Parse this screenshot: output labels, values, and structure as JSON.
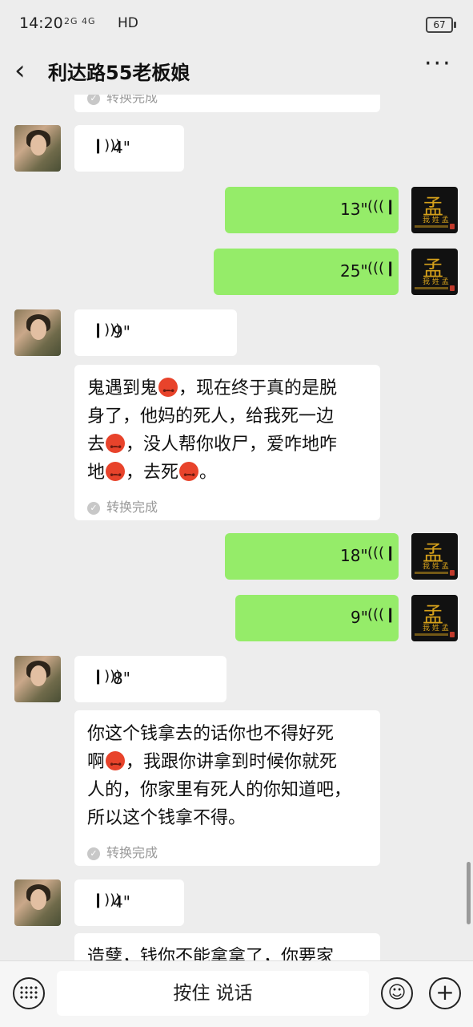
{
  "status_bar": {
    "time": "14:20",
    "signal": "2G 4G",
    "hd": "HD",
    "battery": "67"
  },
  "header": {
    "back_icon": "chevron-left-icon",
    "title": "利达路55老板娘",
    "more_icon": "more-dots-icon"
  },
  "chat": {
    "partial_top_done": "转换完成",
    "voice_icon_left": "))",
    "messages": [
      {
        "side": "left",
        "duration": "4\""
      },
      {
        "side": "right",
        "duration": "13\""
      },
      {
        "side": "right",
        "duration": "25\""
      },
      {
        "side": "left",
        "duration": "9\""
      },
      {
        "side": "right",
        "duration": "18\""
      },
      {
        "side": "right",
        "duration": "9\""
      },
      {
        "side": "left",
        "duration": "8\""
      },
      {
        "side": "left",
        "duration": "4\""
      }
    ],
    "transcripts": [
      {
        "lines": [
          "鬼遇到鬼",
          "，现在终于真的是脱",
          "身了，他妈的死人，给我死一边",
          "去",
          "，没人帮你收尸，爱咋地咋",
          "地",
          "，去死",
          "。"
        ],
        "done": "转换完成"
      },
      {
        "lines": [
          "你这个钱拿去的话你也不得好死",
          "啊",
          "，我跟你讲拿到时候你就死",
          "人的，你家里有死人的你知道吧，",
          "所以这个钱拿不得。"
        ],
        "done": "转换完成"
      },
      {
        "lines": [
          "造孽，钱你不能拿拿了，你要家"
        ]
      }
    ],
    "avatar_right_glyph": "孟",
    "avatar_right_sub": "我 姓 孟"
  },
  "bottom_bar": {
    "keyboard_icon": "keyboard-icon",
    "hold_to_talk": "按住 说话",
    "emoji_icon": "smiley-icon",
    "plus_icon": "plus-icon",
    "smile_glyph": "☺",
    "plus_glyph": "+"
  }
}
